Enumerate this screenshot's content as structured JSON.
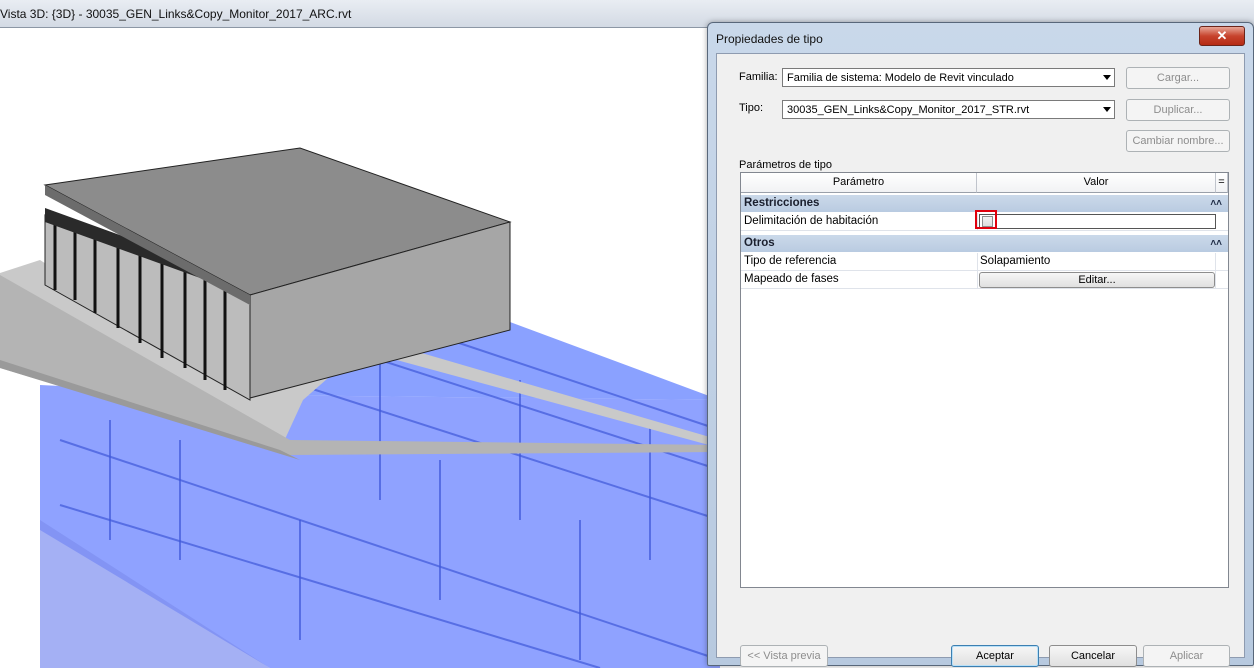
{
  "view": {
    "title": "Vista 3D: {3D} - 30035_GEN_Links&Copy_Monitor_2017_ARC.rvt"
  },
  "dialog": {
    "title": "Propiedades de tipo",
    "close_label": "✕",
    "family_label": "Familia:",
    "family_value": "Familia de sistema: Modelo de Revit vinculado",
    "type_label": "Tipo:",
    "type_value": "30035_GEN_Links&Copy_Monitor_2017_STR.rvt",
    "load_button": "Cargar...",
    "duplicate_button": "Duplicar...",
    "rename_button": "Cambiar nombre...",
    "type_params_label": "Parámetros de tipo",
    "columns": {
      "parameter": "Parámetro",
      "value": "Valor",
      "eq": "="
    },
    "groups": [
      {
        "name": "Restricciones",
        "rows": [
          {
            "param": "Delimitación de habitación",
            "value": "",
            "kind": "checkbox",
            "checked": false
          }
        ]
      },
      {
        "name": "Otros",
        "rows": [
          {
            "param": "Tipo de referencia",
            "value": "Solapamiento",
            "kind": "text"
          },
          {
            "param": "Mapeado de fases",
            "value": "Editar...",
            "kind": "button"
          }
        ]
      }
    ],
    "preview_button": "<< Vista previa",
    "ok_button": "Aceptar",
    "cancel_button": "Cancelar",
    "apply_button": "Aplicar",
    "collapse_icon": "double-chevron-up-icon",
    "highlight_color": "#e0000d"
  }
}
